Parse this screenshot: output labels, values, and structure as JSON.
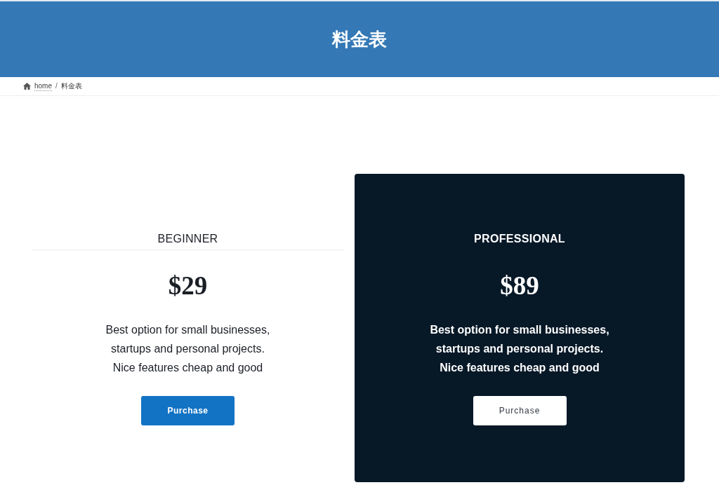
{
  "header": {
    "title": "料金表"
  },
  "breadcrumb": {
    "separator": "/",
    "items": [
      {
        "label": "home",
        "kind": "link"
      },
      {
        "label": "料金表",
        "kind": "current"
      }
    ]
  },
  "plans": [
    {
      "name": "BEGINNER",
      "price": "$29",
      "description": [
        "Best option for small businesses,",
        "startups and personal projects.",
        "Nice features cheap and good"
      ],
      "button": "Purchase",
      "featured": false
    },
    {
      "name": "PROFESSIONAL",
      "price": "$89",
      "description": [
        "Best option for small businesses,",
        "startups and personal projects.",
        "Nice features cheap and good"
      ],
      "button": "Purchase",
      "featured": true
    }
  ]
}
